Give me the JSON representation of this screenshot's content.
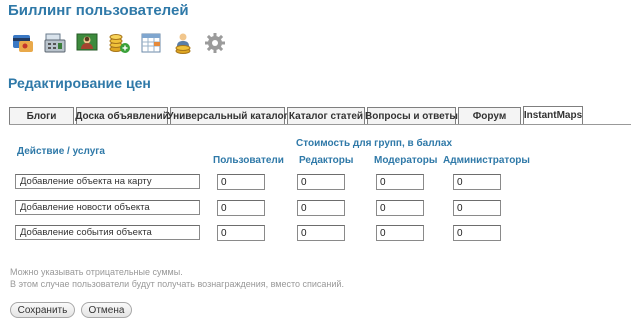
{
  "page": {
    "title": "Биллинг пользователей",
    "section_title": "Редактирование цен"
  },
  "toolbar": {
    "icons": [
      "billing-card-icon",
      "cash-register-icon",
      "users-money-icon",
      "coins-add-icon",
      "price-table-icon",
      "user-coins-icon",
      "gear-icon"
    ]
  },
  "tabs": [
    {
      "label": "Блоги",
      "active": false
    },
    {
      "label": "Доска объявлений",
      "active": false
    },
    {
      "label": "Универсальный каталог",
      "active": false
    },
    {
      "label": "Каталог статей",
      "active": false
    },
    {
      "label": "Вопросы и ответы",
      "active": false
    },
    {
      "label": "Форум",
      "active": false
    },
    {
      "label": "InstantMaps",
      "active": true
    }
  ],
  "table": {
    "action_header": "Действие / услуга",
    "group_header": "Стоимость для групп, в баллах",
    "columns": [
      "Пользователи",
      "Редакторы",
      "Модераторы",
      "Администраторы"
    ],
    "rows": [
      {
        "label": "Добавление объекта на карту",
        "values": [
          "0",
          "0",
          "0",
          "0"
        ]
      },
      {
        "label": "Добавление новости объекта",
        "values": [
          "0",
          "0",
          "0",
          "0"
        ]
      },
      {
        "label": "Добавление события объекта",
        "values": [
          "0",
          "0",
          "0",
          "0"
        ]
      }
    ]
  },
  "notes": {
    "line1": "Можно указывать отрицательные суммы.",
    "line2": "В этом случае пользователи будут получать вознаграждения, вместо списаний."
  },
  "buttons": {
    "save": "Сохранить",
    "cancel": "Отмена"
  }
}
